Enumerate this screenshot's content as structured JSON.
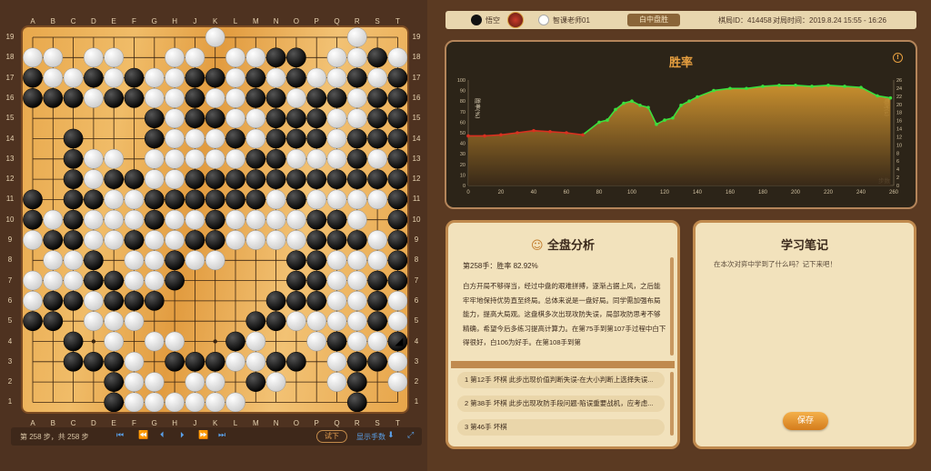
{
  "board": {
    "size": 19,
    "cols": [
      "A",
      "B",
      "C",
      "D",
      "E",
      "F",
      "G",
      "H",
      "J",
      "K",
      "L",
      "M",
      "N",
      "O",
      "P",
      "Q",
      "R",
      "S",
      "T"
    ],
    "rows": [
      "19",
      "18",
      "17",
      "16",
      "15",
      "14",
      "13",
      "12",
      "11",
      "10",
      "9",
      "8",
      "7",
      "6",
      "5",
      "4",
      "3",
      "2",
      "1"
    ],
    "grid": [
      ".........W......W..",
      "WW.WW..WW.WWBB.WWBW",
      "BWWBWBWWBBWBWBWWBWB",
      "BBBWBBWWBWWBBWBBWBB",
      "......BWBBWWBBBWWBB",
      "..B...BWWWBWBBBWBBB",
      "..BWW.WWWWWBBWWWBWB",
      "..BWBBWWBBBBBBBBBBB",
      "B.BBWWBBBBBBWBWWWWB",
      "BWBWWWBWWBWWWWBBW.B",
      "WBBWWBWWBBWWWWBBBWB",
      ".WWB.WWBWW...BBWWWB",
      "WWWBBWWB.....BBWWBB",
      "WBBWBBB.....BBBWWBW",
      "BB.WWW.....BBWWWWBW",
      "..B.W.WW..BW..WBWWB",
      "..BBBW.BBBWWBB.WBBW",
      "....BWW.WW.BW..WB.W",
      "....BWWWWWW.....B.."
    ],
    "last_move": "T4"
  },
  "controls": {
    "move_info": "第 258 步，共 258 步",
    "first_icon": "first-icon",
    "try_label": "试下",
    "show_moves_label": "显示手数"
  },
  "header": {
    "black_player": "悟空",
    "white_player": "智课老师01",
    "result": "白中盘胜",
    "record_id": "棋局ID：414458",
    "play_time": "对局时间：2019.8.24 15:55 - 16:26"
  },
  "chart_data": {
    "type": "line",
    "title": "胜率",
    "ylabel_left": "胜率(%)",
    "ylabel_right": "用时(s)",
    "xlabel": "步数",
    "xlim": [
      0,
      260
    ],
    "ylim_left": [
      0,
      100
    ],
    "ylim_right": [
      0,
      26
    ],
    "xticks": [
      0,
      20,
      40,
      60,
      80,
      100,
      120,
      140,
      160,
      180,
      200,
      220,
      240,
      260
    ],
    "yticks_left": [
      0,
      10,
      20,
      30,
      40,
      50,
      60,
      70,
      80,
      90,
      100
    ],
    "yticks_right": [
      0,
      2,
      4,
      6,
      8,
      10,
      12,
      14,
      16,
      18,
      20,
      22,
      24,
      26
    ],
    "series": [
      {
        "name": "胜率",
        "x": [
          0,
          10,
          20,
          30,
          40,
          50,
          60,
          70,
          80,
          85,
          90,
          95,
          100,
          105,
          110,
          115,
          120,
          125,
          130,
          135,
          140,
          150,
          160,
          170,
          180,
          190,
          200,
          210,
          220,
          230,
          240,
          250,
          258
        ],
        "values": [
          47,
          47,
          48,
          50,
          52,
          51,
          50,
          48,
          60,
          62,
          72,
          78,
          80,
          76,
          74,
          58,
          62,
          64,
          76,
          80,
          84,
          90,
          92,
          92,
          94,
          95,
          95,
          94,
          95,
          94,
          93,
          85,
          83
        ]
      }
    ]
  },
  "analysis": {
    "title": "全盘分析",
    "summary": "第258手：胜率 82.92%",
    "text": "白方开局不够得当，经过中盘的艰难拼搏，逐渐占据上风，之后能牢牢地保持优势直至终局。总体来说是一盘好局。同学需加强布局能力，提高大局观。这盘棋多次出现攻防失误，局部攻防思考不够精确，希望今后多练习提高计算力。在第75手到第107手过程中白下得很好，白106为好手。在第108手到第",
    "items": [
      "1 第12手 坏棋 此步出现价值判断失误-在大小判断上选择失误...",
      "2 第38手 坏棋 此步出现攻防手段问题-陷误重要战机，应考虑...",
      "3 第46手 坏棋"
    ]
  },
  "notes": {
    "title": "学习笔记",
    "placeholder": "在本次对弈中学到了什么吗？记下来吧！",
    "save_label": "保存"
  }
}
